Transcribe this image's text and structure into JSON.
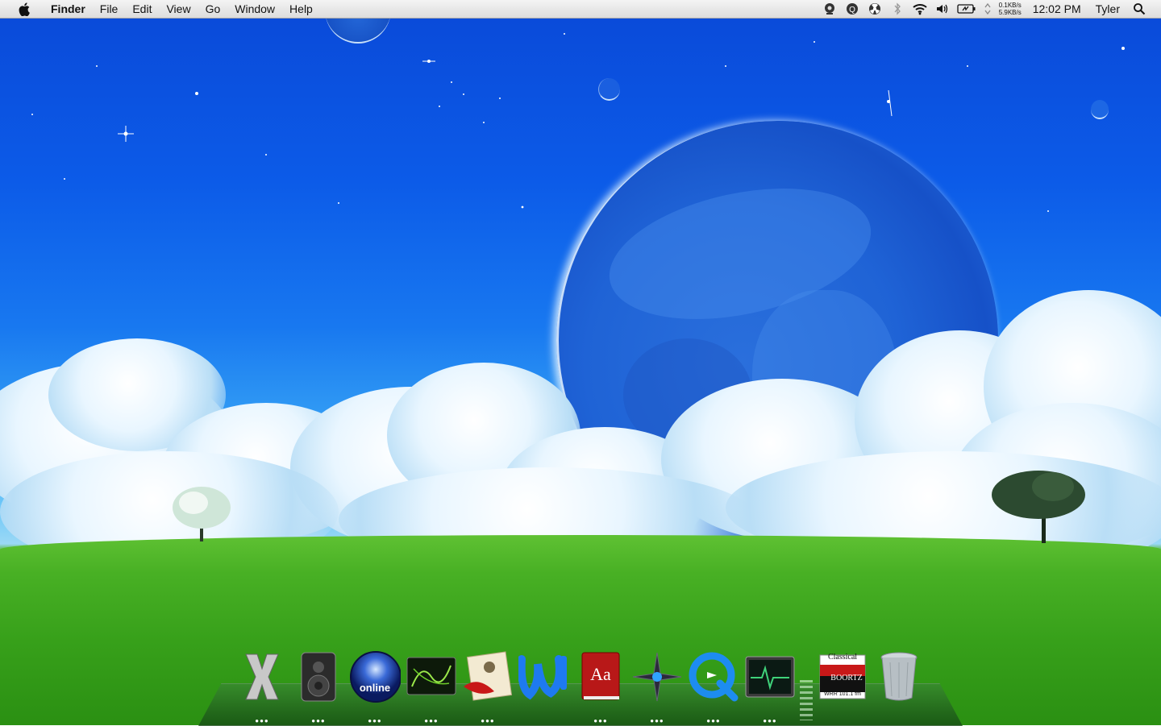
{
  "menubar": {
    "app_name": "Finder",
    "menus": [
      "File",
      "Edit",
      "View",
      "Go",
      "Window",
      "Help"
    ],
    "net_up": "0.1KB/s",
    "net_down": "5.9KB/s",
    "clock": "12:02 PM",
    "user": "Tyler"
  },
  "status_icons": [
    "webcam-icon",
    "quicksilver-icon",
    "radiation-icon",
    "bluetooth-icon",
    "wifi-icon",
    "volume-icon",
    "battery-icon",
    "updown-arrows-icon",
    "spotlight-icon"
  ],
  "dock": {
    "items": [
      {
        "name": "mac-os-x",
        "running": true
      },
      {
        "name": "speaker",
        "running": true
      },
      {
        "name": "online-globe",
        "running": true,
        "label": "online"
      },
      {
        "name": "network-monitor",
        "running": true
      },
      {
        "name": "letter-quill",
        "running": true
      },
      {
        "name": "word",
        "running": false
      },
      {
        "name": "dictionary",
        "running": true,
        "label": "Aa"
      },
      {
        "name": "compass",
        "running": true
      },
      {
        "name": "quicktime",
        "running": true
      },
      {
        "name": "activity-monitor",
        "running": true
      },
      {
        "name": "radio-station",
        "running": false,
        "label_top": "Classical",
        "label_mid": "BOORTZ",
        "label_bot": "WRR 101.1 fm"
      },
      {
        "name": "trash",
        "running": false
      }
    ]
  },
  "colors": {
    "sky": "#0c5be8",
    "grass": "#3ca21d",
    "menubar": "#e8e8e8"
  }
}
